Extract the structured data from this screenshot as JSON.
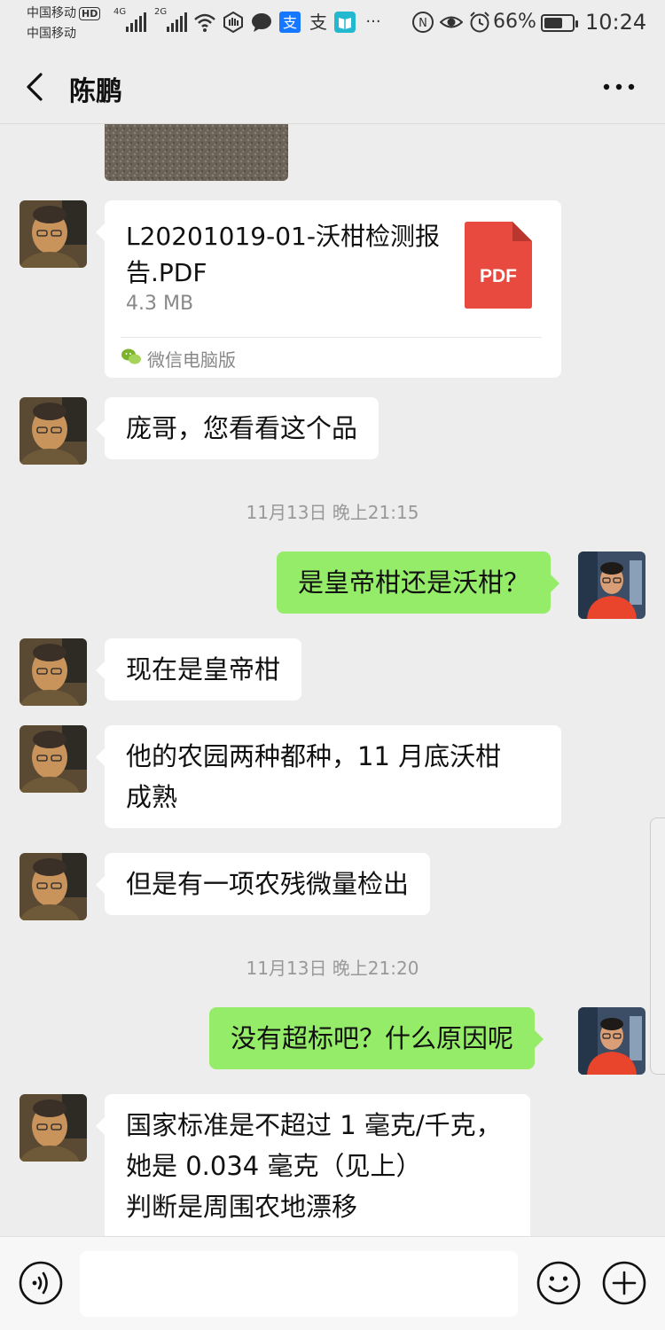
{
  "status_bar": {
    "carrier_1": "中国移动",
    "carrier_1_badge": "HD",
    "carrier_2": "中国移动",
    "signal_1_label": "4G",
    "signal_2_label": "2G",
    "battery_percent": "66%",
    "battery_level": 0.66,
    "time": "10:24",
    "icons": [
      "wifi-icon",
      "hand-icon",
      "chat-bubble-icon",
      "alipay-icon",
      "alipay-icon",
      "reader-icon",
      "more-notifications-icon",
      "nfc-icon",
      "eye-icon",
      "alarm-icon",
      "battery-icon"
    ],
    "overflow": "···"
  },
  "nav": {
    "title": "陈鹏"
  },
  "messages": [
    {
      "type": "file",
      "file_name": "L20201019-01-沃柑检测报告.PDF",
      "file_size": "4.3 MB",
      "file_badge": "PDF",
      "source": "微信电脑版"
    },
    {
      "type": "text",
      "side": "in",
      "text": "庞哥，您看看这个品"
    },
    {
      "type": "time",
      "text": "11月13日 晚上21:15"
    },
    {
      "type": "text",
      "side": "out",
      "text": "是皇帝柑还是沃柑？"
    },
    {
      "type": "text",
      "side": "in",
      "text": "现在是皇帝柑"
    },
    {
      "type": "text",
      "side": "in",
      "text": "他的农园两种都种，11 月底沃柑\n成熟"
    },
    {
      "type": "text",
      "side": "in",
      "text": "但是有一项农残微量检出"
    },
    {
      "type": "time",
      "text": "11月13日 晚上21:20"
    },
    {
      "type": "text",
      "side": "out",
      "text": "没有超标吧？什么原因呢"
    },
    {
      "type": "text",
      "side": "in",
      "text": "国家标准是不超过 1 毫克/千克，\n她是 0.034 毫克（见上）\n判断是周围农地漂移"
    }
  ],
  "input": {
    "value": "",
    "placeholder": ""
  },
  "colors": {
    "background": "#ededed",
    "outgoing_bubble": "#95ec69",
    "incoming_bubble": "#ffffff",
    "pdf_icon": "#e84a3f"
  }
}
